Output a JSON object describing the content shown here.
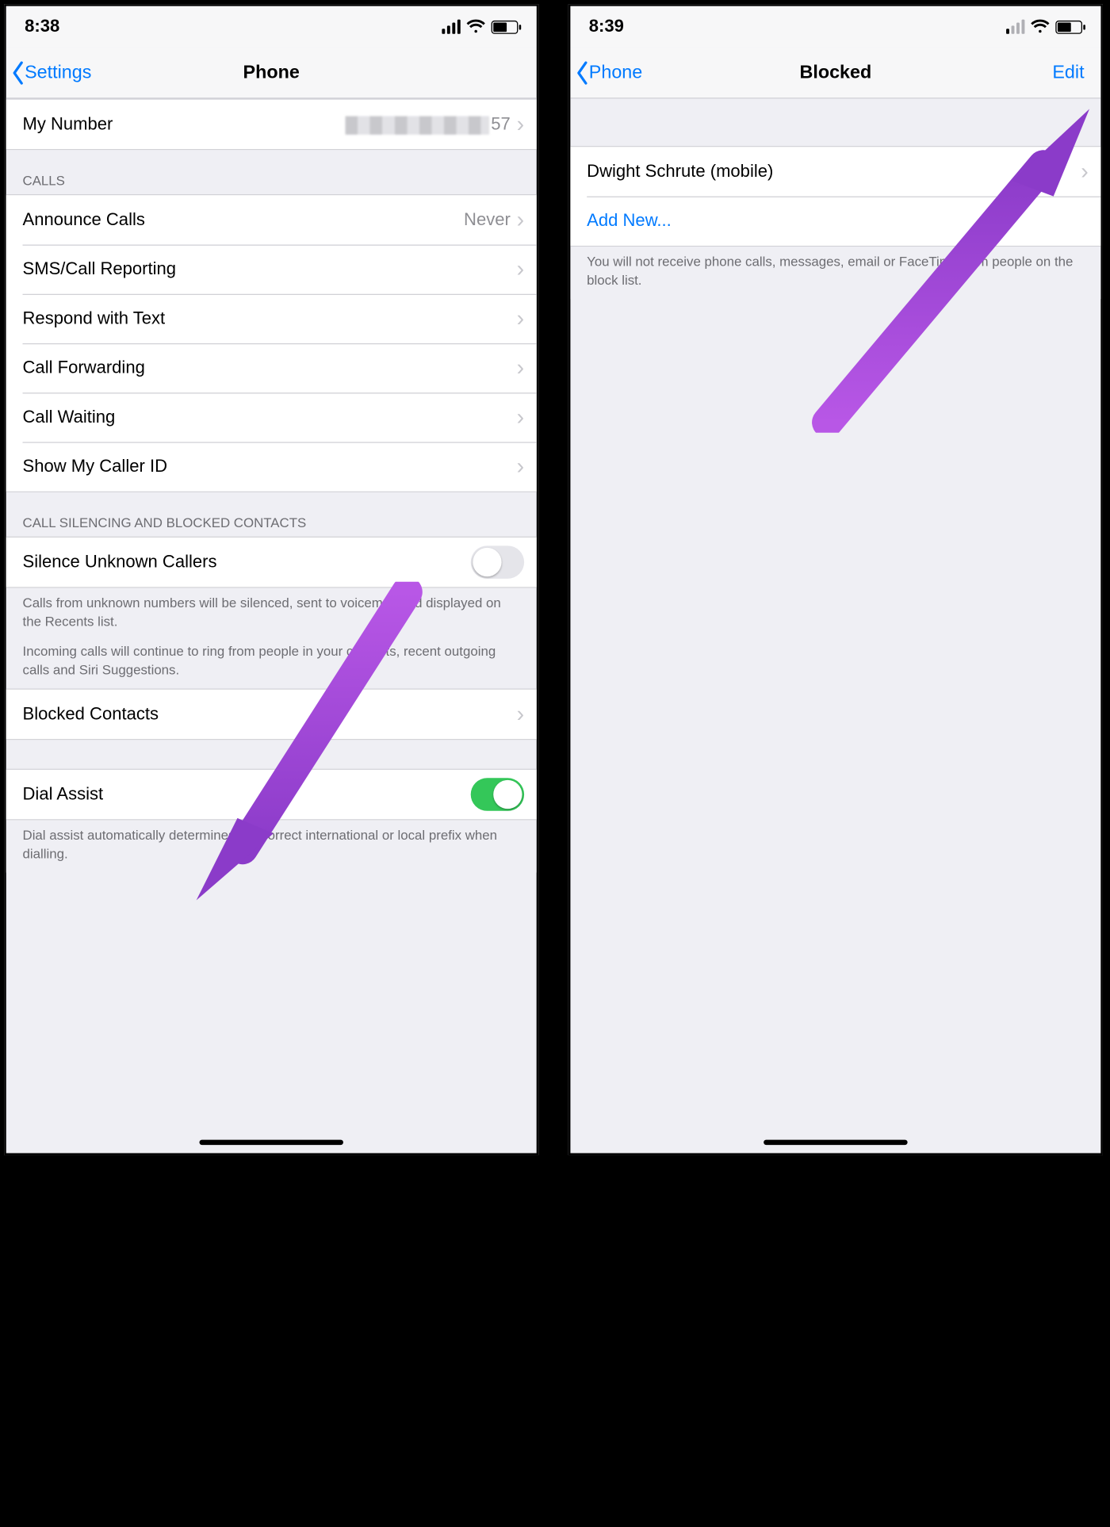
{
  "left": {
    "status": {
      "time": "8:38"
    },
    "nav": {
      "back": "Settings",
      "title": "Phone"
    },
    "myNumber": {
      "label": "My Number",
      "suffix": "57"
    },
    "callsHeader": "CALLS",
    "calls": [
      {
        "label": "Announce Calls",
        "value": "Never"
      },
      {
        "label": "SMS/Call Reporting",
        "value": ""
      },
      {
        "label": "Respond with Text",
        "value": ""
      },
      {
        "label": "Call Forwarding",
        "value": ""
      },
      {
        "label": "Call Waiting",
        "value": ""
      },
      {
        "label": "Show My Caller ID",
        "value": ""
      }
    ],
    "silencingHeader": "CALL SILENCING AND BLOCKED CONTACTS",
    "silenceRow": {
      "label": "Silence Unknown Callers",
      "on": false
    },
    "silenceFooter1": "Calls from unknown numbers will be silenced, sent to voicemail and displayed on the Recents list.",
    "silenceFooter2": "Incoming calls will continue to ring from people in your contacts, recent outgoing calls and Siri Suggestions.",
    "blockedRow": {
      "label": "Blocked Contacts"
    },
    "dialAssist": {
      "label": "Dial Assist",
      "on": true
    },
    "dialFooter": "Dial assist automatically determines the correct international or local prefix when dialling."
  },
  "right": {
    "status": {
      "time": "8:39"
    },
    "nav": {
      "back": "Phone",
      "title": "Blocked",
      "edit": "Edit"
    },
    "blocked": [
      {
        "label": "Dwight Schrute (mobile)"
      }
    ],
    "addNew": "Add New...",
    "footer": "You will not receive phone calls, messages, email or FaceTime from people on the block list."
  }
}
